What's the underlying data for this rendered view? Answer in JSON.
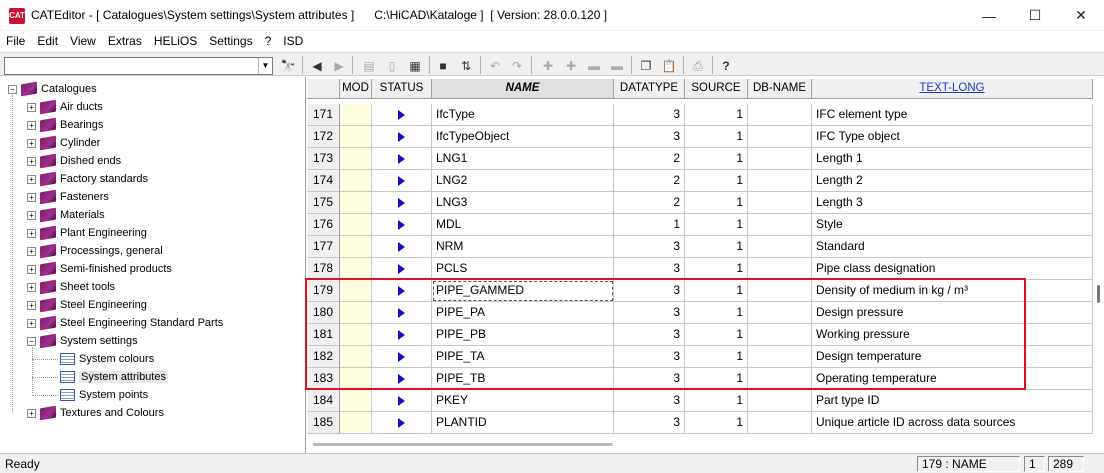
{
  "window": {
    "title": "CATEditor - [ Catalogues\\System settings\\System attributes ]      C:\\HiCAD\\Kataloge ]  [ Version: 28.0.0.120 ]",
    "app_icon_text": "CAT",
    "minimize_glyph": "—",
    "maximize_glyph": "☐",
    "close_glyph": "✕"
  },
  "menu": [
    "File",
    "Edit",
    "View",
    "Extras",
    "HELiOS",
    "Settings",
    "?",
    "ISD"
  ],
  "toolbar": {
    "combo_value": "",
    "combo_arrow": "▼",
    "find_glyph": "🔭"
  },
  "tree": {
    "root": "Catalogues",
    "items": [
      "Air ducts",
      "Bearings",
      "Cylinder",
      "Dished ends",
      "Factory standards",
      "Fasteners",
      "Materials",
      "Plant Engineering",
      "Processings, general",
      "Semi-finished products",
      "Sheet tools",
      "Steel Engineering",
      "Steel Engineering Standard Parts",
      "System settings"
    ],
    "system_children": [
      "System colours",
      "System attributes",
      "System points"
    ],
    "last_item": "Textures and Colours",
    "plus": "+",
    "minus": "−"
  },
  "grid": {
    "headers": {
      "mod": "MOD",
      "status": "STATUS",
      "name": "NAME",
      "datatype": "DATATYPE",
      "source": "SOURCE",
      "dbname": "DB-NAME",
      "textlong": "TEXT-LONG"
    },
    "rows": [
      {
        "num": "171",
        "name": "IfcType",
        "datatype": "3",
        "source": "1",
        "dbname": "",
        "text": "IFC element type"
      },
      {
        "num": "172",
        "name": "IfcTypeObject",
        "datatype": "3",
        "source": "1",
        "dbname": "",
        "text": "IFC Type object"
      },
      {
        "num": "173",
        "name": "LNG1",
        "datatype": "2",
        "source": "1",
        "dbname": "",
        "text": "Length 1"
      },
      {
        "num": "174",
        "name": "LNG2",
        "datatype": "2",
        "source": "1",
        "dbname": "",
        "text": "Length 2"
      },
      {
        "num": "175",
        "name": "LNG3",
        "datatype": "2",
        "source": "1",
        "dbname": "",
        "text": "Length 3"
      },
      {
        "num": "176",
        "name": "MDL",
        "datatype": "1",
        "source": "1",
        "dbname": "",
        "text": "Style"
      },
      {
        "num": "177",
        "name": "NRM",
        "datatype": "3",
        "source": "1",
        "dbname": "",
        "text": "Standard"
      },
      {
        "num": "178",
        "name": "PCLS",
        "datatype": "3",
        "source": "1",
        "dbname": "",
        "text": "Pipe class designation"
      },
      {
        "num": "179",
        "name": "PIPE_GAMMED",
        "datatype": "3",
        "source": "1",
        "dbname": "",
        "text": "Density of medium in kg / m³"
      },
      {
        "num": "180",
        "name": "PIPE_PA",
        "datatype": "3",
        "source": "1",
        "dbname": "",
        "text": "Design pressure"
      },
      {
        "num": "181",
        "name": "PIPE_PB",
        "datatype": "3",
        "source": "1",
        "dbname": "",
        "text": "Working pressure"
      },
      {
        "num": "182",
        "name": "PIPE_TA",
        "datatype": "3",
        "source": "1",
        "dbname": "",
        "text": "Design temperature"
      },
      {
        "num": "183",
        "name": "PIPE_TB",
        "datatype": "3",
        "source": "1",
        "dbname": "",
        "text": "Operating temperature"
      },
      {
        "num": "184",
        "name": "PKEY",
        "datatype": "3",
        "source": "1",
        "dbname": "",
        "text": "Part type ID"
      },
      {
        "num": "185",
        "name": "PLANTID",
        "datatype": "3",
        "source": "1",
        "dbname": "",
        "text": "Unique article ID across data sources"
      }
    ]
  },
  "statusbar": {
    "text": "Ready",
    "cell": "179 : NAME",
    "count1": "1",
    "count2": "289"
  },
  "colors": {
    "highlight": "#e01020",
    "status_arrow": "#1010c8",
    "mod_bg": "#fefde0",
    "book": "#a0308e"
  }
}
